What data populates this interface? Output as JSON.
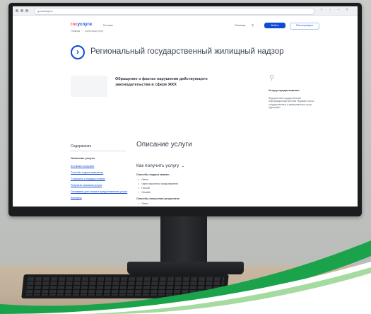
{
  "browser": {
    "url": "gosuslugi.ru",
    "tab_title": "Региональный государственный жилищный надзор"
  },
  "site": {
    "logo_part1": "гос",
    "logo_part2": "услуги",
    "region": "Москва",
    "header_links": [
      "Помощь"
    ],
    "login_label": "Войти",
    "register_label": "Регистрация"
  },
  "breadcrumbs": [
    "Главная",
    "Категории услуг"
  ],
  "page": {
    "title": "Региональный государственный жилищный надзор"
  },
  "info": {
    "thumb_text": "",
    "lead": "Обращение о фактах нарушения действующего законодательства в сфере ЖКХ",
    "aside_heading": "Услугу предоставляет",
    "aside_text": "Федеральная государственная информационная система «Единый портал государственных и муниципальных услуг (функций)»"
  },
  "nav": {
    "title": "Содержание",
    "section": "Описание услуги",
    "links": [
      "Кто может получить",
      "Способы подачи заявления",
      "Стоимость и порядок оплаты",
      "Результат оказания услуги",
      "Основания для отказа в предоставлении услуги",
      "Контакты"
    ]
  },
  "main": {
    "heading": "Описание услуги",
    "how_to": "Как получить услугу",
    "block1_title": "Способы подачи заявки:",
    "block1_items": [
      "Лично",
      "Через законного представителя",
      "Почтой",
      "Онлайн"
    ],
    "block2_title": "Способы получения результата:",
    "block2_items": [
      "Лично"
    ]
  },
  "colors": {
    "brand_blue": "#0d4cd3",
    "brand_red": "#ee3f58",
    "accent_green": "#1aa34a"
  }
}
